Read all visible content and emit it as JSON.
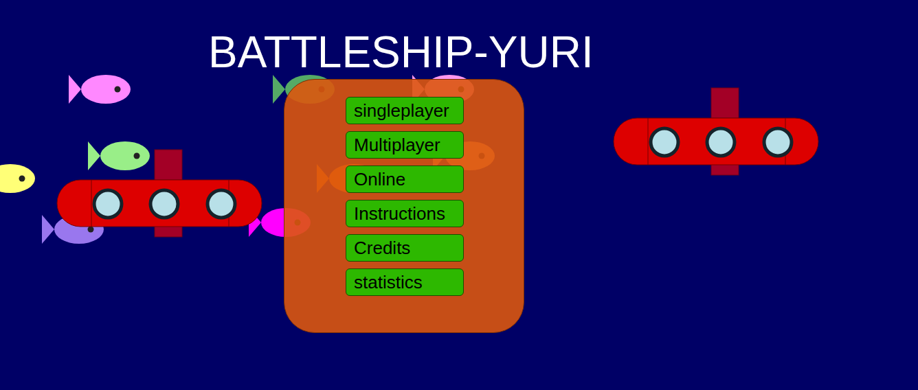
{
  "title": "BATTLESHIP-YURI",
  "menu": [
    {
      "label": "singleplayer"
    },
    {
      "label": "Multiplayer"
    },
    {
      "label": "Online"
    },
    {
      "label": "Instructions"
    },
    {
      "label": "Credits"
    },
    {
      "label": "statistics"
    }
  ]
}
